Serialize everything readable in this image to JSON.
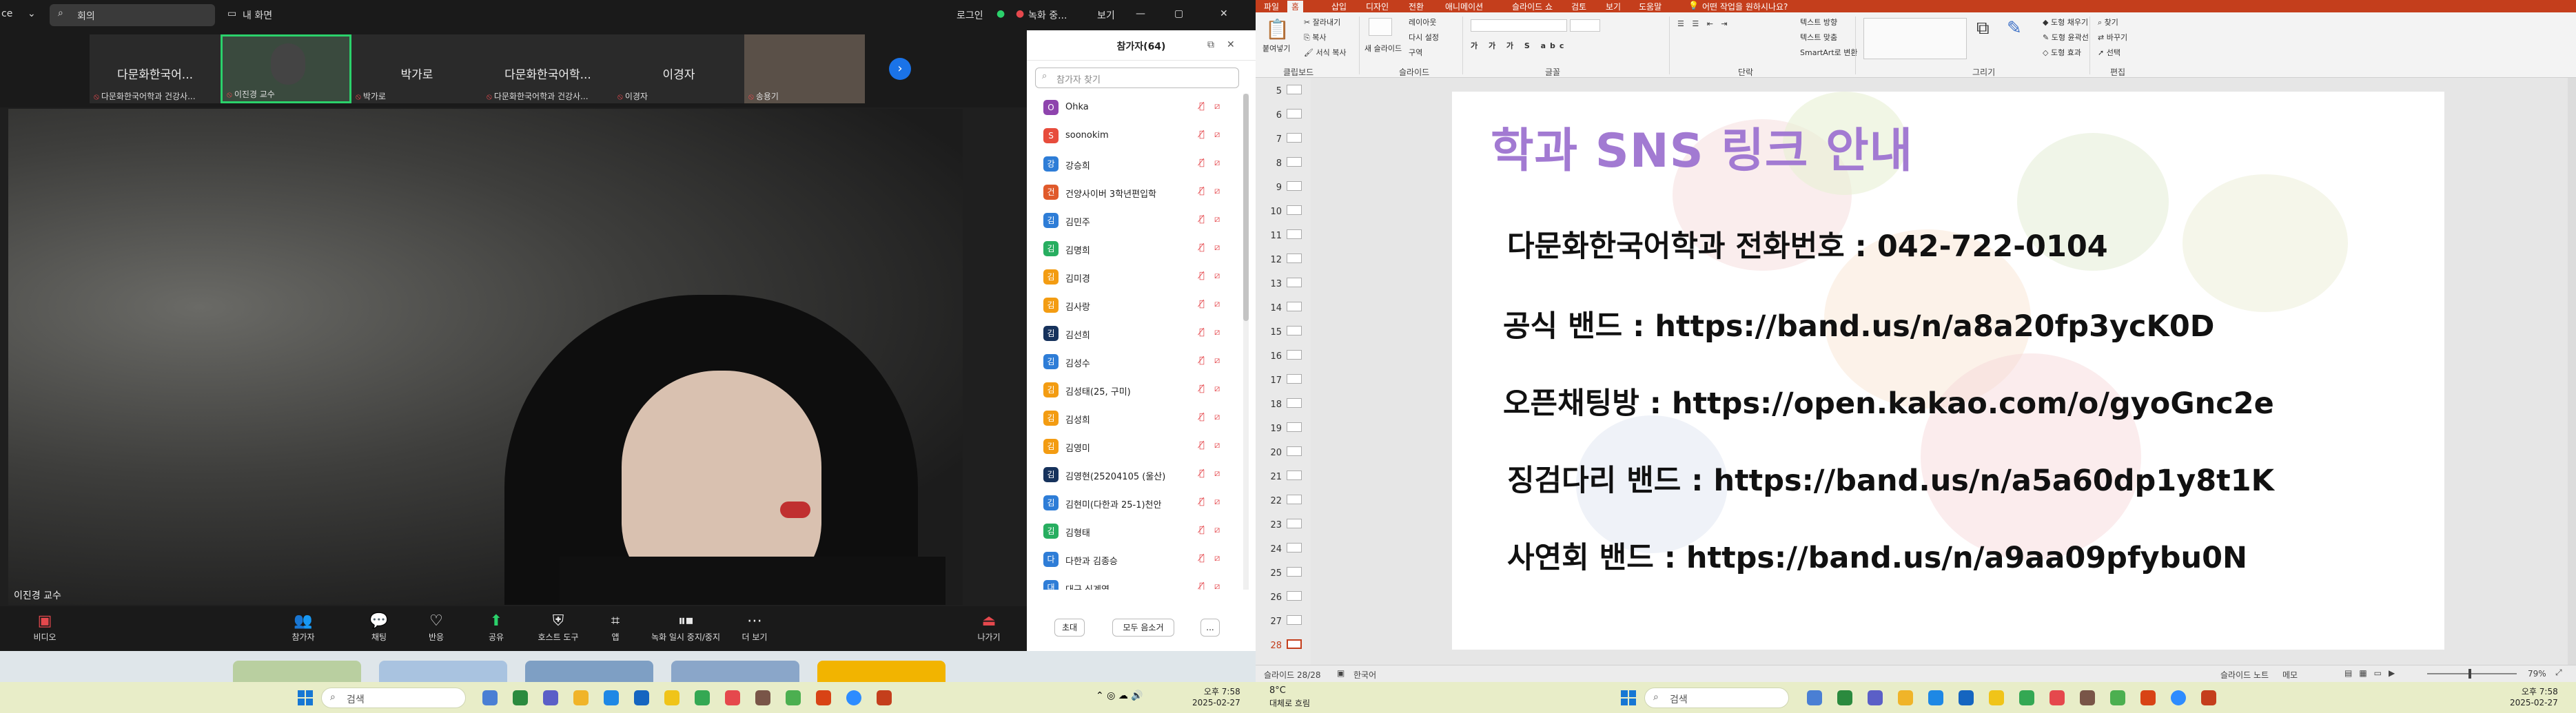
{
  "zoom": {
    "titlebar": {
      "left_label": "ce",
      "meeting_search": "회의",
      "view_label": "내 화면",
      "login_label": "로그인",
      "recording_label": "녹화 중...",
      "view_menu": "보기"
    },
    "tiles": [
      {
        "name": "다문화한국어...",
        "label": "다문화한국어학과 건강사..."
      },
      {
        "name": "",
        "label": "이진경 교수"
      },
      {
        "name": "박가로",
        "label": "박가로"
      },
      {
        "name": "다문화한국어학...",
        "label": "다문화한국어학과 건강사..."
      },
      {
        "name": "이경자",
        "label": "이경자"
      },
      {
        "name": "",
        "label": "송용기"
      }
    ],
    "video_label": "이진경 교수",
    "controls": [
      {
        "icon": "video-off-icon",
        "glyph": "▣",
        "label": "비디오"
      },
      {
        "icon": "participants-icon",
        "glyph": "👥",
        "label": "참가자",
        "count": "64"
      },
      {
        "icon": "chat-icon",
        "glyph": "💬",
        "label": "채팅"
      },
      {
        "icon": "reaction-icon",
        "glyph": "♡",
        "label": "반응"
      },
      {
        "icon": "share-icon",
        "glyph": "⬆",
        "label": "공유"
      },
      {
        "icon": "host-tools-icon",
        "glyph": "⛨",
        "label": "호스트 도구"
      },
      {
        "icon": "apps-icon",
        "glyph": "⌗",
        "label": "앱"
      },
      {
        "icon": "recording-icon",
        "glyph": "⏸",
        "label": "녹화 일시 중지/중지"
      },
      {
        "icon": "more-icon",
        "glyph": "⋯",
        "label": "더 보기"
      },
      {
        "icon": "leave-icon",
        "glyph": "⏏",
        "label": "나가기"
      }
    ],
    "panel": {
      "title": "참가자(64)",
      "search_placeholder": "참가자 찾기",
      "participants": [
        {
          "name": "Ohka",
          "initial": "O",
          "color": "#8e44ad"
        },
        {
          "name": "soonokim",
          "initial": "S",
          "color": "#e74c3c"
        },
        {
          "name": "강승희",
          "initial": "강",
          "color": "#2e7dd7"
        },
        {
          "name": "건양사이버 3학년편입학",
          "initial": "건",
          "color": "#e05a2b"
        },
        {
          "name": "김민주",
          "initial": "김",
          "color": "#2e7dd7"
        },
        {
          "name": "김명희",
          "initial": "김",
          "color": "#27ae60"
        },
        {
          "name": "김미경",
          "initial": "김",
          "color": "#f39c12"
        },
        {
          "name": "김사랑",
          "initial": "김",
          "color": "#f39c12"
        },
        {
          "name": "김선희",
          "initial": "김",
          "color": "#16325c"
        },
        {
          "name": "김성수",
          "initial": "김",
          "color": "#2e7dd7"
        },
        {
          "name": "김성태(25, 구미)",
          "initial": "김",
          "color": "#f39c12"
        },
        {
          "name": "김성희",
          "initial": "김",
          "color": "#f39c12"
        },
        {
          "name": "김영미",
          "initial": "김",
          "color": "#f39c12"
        },
        {
          "name": "김영현(25204105 (울산)",
          "initial": "김",
          "color": "#16325c"
        },
        {
          "name": "김현미(다한과 25-1)천안",
          "initial": "김",
          "color": "#2e7dd7"
        },
        {
          "name": "김형태",
          "initial": "김",
          "color": "#27ae60"
        },
        {
          "name": "다한과 김종승",
          "initial": "다",
          "color": "#2e7dd7"
        },
        {
          "name": "대구 신계영",
          "initial": "대",
          "color": "#2e7dd7"
        }
      ],
      "invite_label": "초대",
      "mute_all_label": "모두 음소거",
      "more_label": "..."
    }
  },
  "ppt": {
    "tabs": [
      "파일",
      "홈",
      "삽입",
      "디자인",
      "전환",
      "애니메이션",
      "슬라이드 쇼",
      "검토",
      "보기",
      "도움말",
      "어떤 작업을 원하시나요?"
    ],
    "active_tab": "홈",
    "ribbon": {
      "paste_label": "붙여넣기",
      "cut_label": "잘라내기",
      "copy_label": "복사",
      "format_painter_label": "서식 복사",
      "new_slide_label": "새 슬라이드",
      "layout_label": "레이아웃",
      "reset_label": "다시 설정",
      "section_label": "구역",
      "text_direction_label": "텍스트 방향",
      "align_text_label": "텍스트 맞춤",
      "smartart_label": "SmartArt로 변환",
      "find_label": "찾기",
      "replace_label": "바꾸기",
      "select_label": "선택",
      "shape_fill_label": "도형 채우기",
      "shape_outline_label": "도형 윤곽선",
      "shape_effects_label": "도형 효과",
      "groups": [
        "클립보드",
        "슬라이드",
        "글꼴",
        "단락",
        "그리기",
        "편집"
      ]
    },
    "thumbnails": [
      "5",
      "6",
      "7",
      "8",
      "9",
      "10",
      "11",
      "12",
      "13",
      "14",
      "15",
      "16",
      "17",
      "18",
      "19",
      "20",
      "21",
      "22",
      "23",
      "24",
      "25",
      "26",
      "27",
      "28"
    ],
    "active_slide": "28",
    "slide": {
      "title": "학과 SNS 링크 안내",
      "lines": [
        "다문화한국어학과 전화번호 : 042-722-0104",
        "공식 밴드 : https://band.us/n/a8a20fp3ycK0D",
        "오픈채팅방 : https://open.kakao.com/o/gyoGnc2e",
        "징검다리 밴드 : https://band.us/n/a5a60dp1y8t1K",
        "사연회 밴드 : https://band.us/n/a9aa09pfybu0N"
      ]
    },
    "status": {
      "slide_count": "슬라이드 28/28",
      "language": "한국어",
      "notes_label": "슬라이드 노트",
      "comments_label": "메모",
      "zoom": "79%"
    }
  },
  "taskbar": {
    "search_placeholder": "검색",
    "left_time": "오후 7:58",
    "left_date": "2025-02-27",
    "right_weather": "8°C",
    "right_weather_desc": "대체로 흐림",
    "right_time": "오후 7:58",
    "right_date": "2025-02-27"
  }
}
